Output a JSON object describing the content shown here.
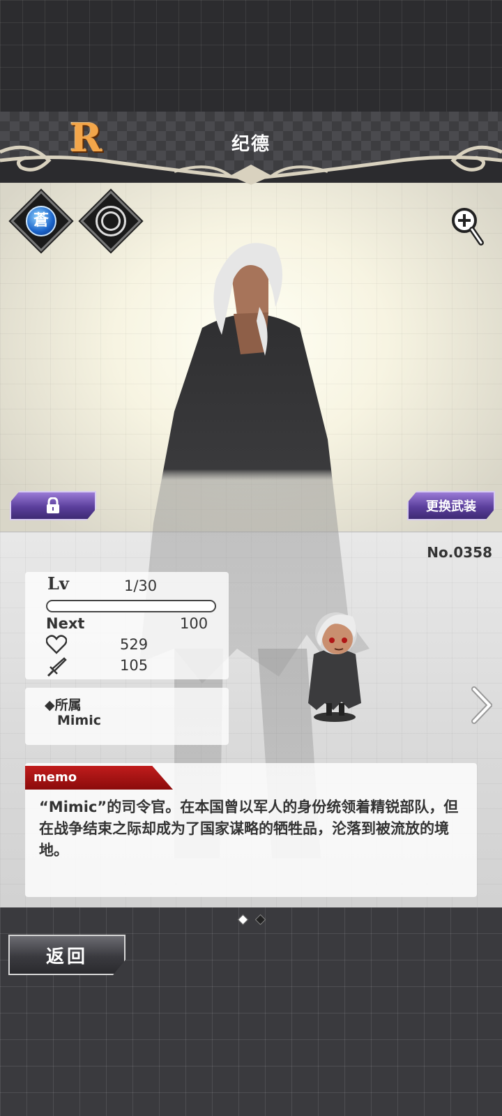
{
  "header": {
    "rarity": "R",
    "name": "纪德"
  },
  "icons": {
    "attribute": "blue-attribute-icon",
    "skill": "ring-skill-icon",
    "zoom": "zoom-in-icon",
    "lock": "lock-icon"
  },
  "buttons": {
    "change_weapon": "更换武装",
    "back": "返回"
  },
  "card": {
    "number": "No.0358",
    "level_label": "Lv",
    "level": "1/30",
    "xp_fraction": 0.0,
    "next_label": "Next",
    "next_value": "100",
    "hp": "529",
    "attack": "105",
    "faction_label": "◆所属",
    "faction": "Mimic"
  },
  "memo": {
    "tag": "memo",
    "text": "“Mimic”的司令官。在本国曾以军人的身份统领着精锐部队，但在战争结束之际却成为了国家谋略的牺牲品，沦落到被流放的境地。"
  },
  "pager": {
    "pages": 2,
    "current": 1
  },
  "colors": {
    "accent_purple": "#5b3f9c",
    "memo_red": "#b01515",
    "rarity_orange": "#f3a64a"
  }
}
